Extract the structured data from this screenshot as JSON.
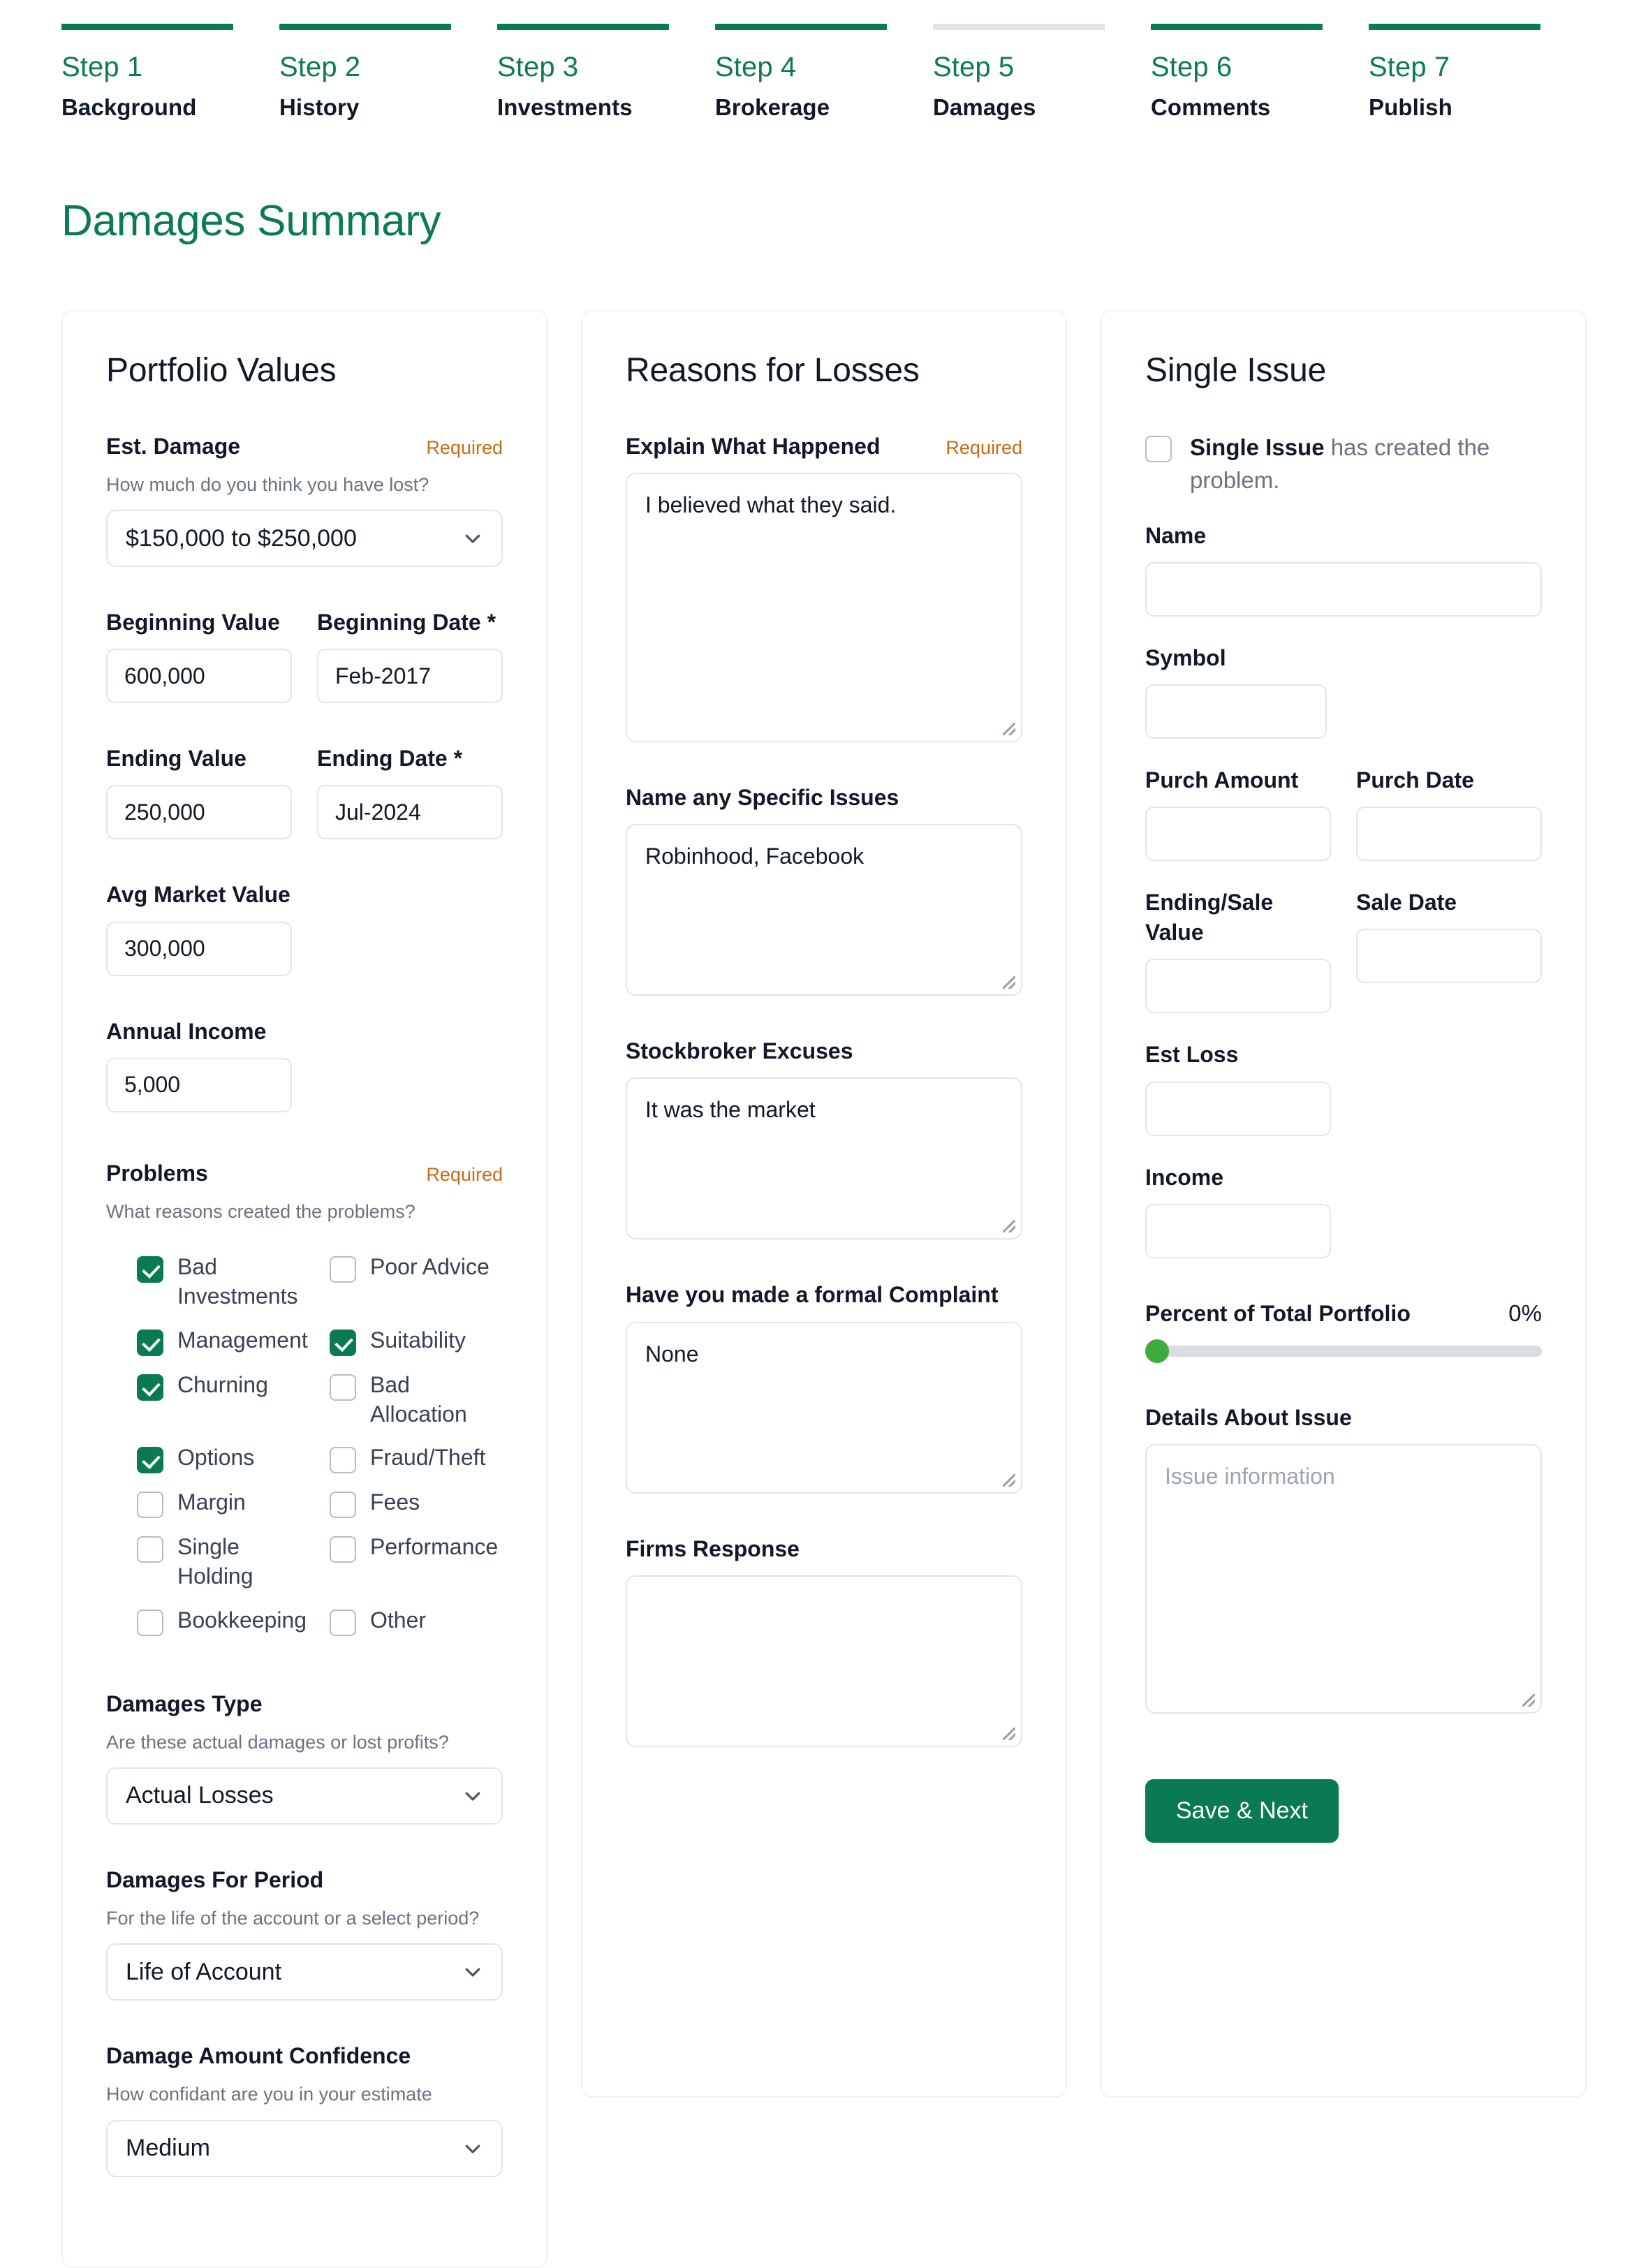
{
  "stepper": {
    "steps": [
      {
        "num": "Step 1",
        "name": "Background",
        "state": "done"
      },
      {
        "num": "Step 2",
        "name": "History",
        "state": "done"
      },
      {
        "num": "Step 3",
        "name": "Investments",
        "state": "done"
      },
      {
        "num": "Step 4",
        "name": "Brokerage",
        "state": "done"
      },
      {
        "num": "Step 5",
        "name": "Damages",
        "state": "current"
      },
      {
        "num": "Step 6",
        "name": "Comments",
        "state": "done"
      },
      {
        "num": "Step 7",
        "name": "Publish",
        "state": "done"
      }
    ]
  },
  "page": {
    "title": "Damages Summary"
  },
  "colors": {
    "brand_green": "#0b7a55",
    "required_orange": "#cc6a15",
    "checkbox_green": "#0b7a50",
    "slider_thumb_green": "#3faa3f",
    "step_inactive_gray": "#e3e6e8"
  },
  "portfolio": {
    "title": "Portfolio Values",
    "est_damage": {
      "label": "Est. Damage",
      "required": "Required",
      "help": "How much do you think you have lost?",
      "value": "$150,000 to $250,000"
    },
    "beginning_value": {
      "label": "Beginning Value",
      "value": "600,000"
    },
    "beginning_date": {
      "label": "Beginning Date *",
      "value": "Feb-2017"
    },
    "ending_value": {
      "label": "Ending Value",
      "value": "250,000"
    },
    "ending_date": {
      "label": "Ending Date *",
      "value": "Jul-2024"
    },
    "avg_market_value": {
      "label": "Avg Market Value",
      "value": "300,000"
    },
    "annual_income": {
      "label": "Annual Income",
      "value": "5,000"
    },
    "problems": {
      "label": "Problems",
      "required": "Required",
      "help": "What reasons created the problems?",
      "options": [
        {
          "label": "Bad Investments",
          "checked": true
        },
        {
          "label": "Poor Advice",
          "checked": false
        },
        {
          "label": "Management",
          "checked": true
        },
        {
          "label": "Suitability",
          "checked": true
        },
        {
          "label": "Churning",
          "checked": true
        },
        {
          "label": "Bad Allocation",
          "checked": false
        },
        {
          "label": "Options",
          "checked": true
        },
        {
          "label": "Fraud/Theft",
          "checked": false
        },
        {
          "label": "Margin",
          "checked": false
        },
        {
          "label": "Fees",
          "checked": false
        },
        {
          "label": "Single Holding",
          "checked": false
        },
        {
          "label": "Performance",
          "checked": false
        },
        {
          "label": "Bookkeeping",
          "checked": false
        },
        {
          "label": "Other",
          "checked": false
        }
      ]
    },
    "damages_type": {
      "label": "Damages Type",
      "help": "Are these actual damages or lost profits?",
      "value": "Actual Losses"
    },
    "damages_period": {
      "label": "Damages For Period",
      "help": "For the life of the account or a select period?",
      "value": "Life of Account"
    },
    "damage_confidence": {
      "label": "Damage Amount Confidence",
      "help": "How confidant are you in your estimate",
      "value": "Medium"
    }
  },
  "reasons": {
    "title": "Reasons for Losses",
    "explain": {
      "label": "Explain What Happened",
      "required": "Required",
      "value": "I believed what they said."
    },
    "specific_issues": {
      "label": "Name any Specific Issues",
      "value": "Robinhood, Facebook"
    },
    "excuses": {
      "label": "Stockbroker Excuses",
      "value": "It was the market"
    },
    "complaint": {
      "label": "Have you made a formal Complaint",
      "value": "None"
    },
    "firms_response": {
      "label": "Firms Response",
      "value": ""
    }
  },
  "single_issue": {
    "title": "Single Issue",
    "checkbox": {
      "strong": "Single Issue",
      "rest": " has created the problem.",
      "checked": false
    },
    "name": {
      "label": "Name",
      "value": ""
    },
    "symbol": {
      "label": "Symbol",
      "value": ""
    },
    "purch_amount": {
      "label": "Purch Amount",
      "value": ""
    },
    "purch_date": {
      "label": "Purch Date",
      "value": ""
    },
    "ending_sale_value": {
      "label": "Ending/Sale Value",
      "value": ""
    },
    "sale_date": {
      "label": "Sale Date",
      "value": ""
    },
    "est_loss": {
      "label": "Est Loss",
      "value": ""
    },
    "income": {
      "label": "Income",
      "value": ""
    },
    "percent_of_portfolio": {
      "label": "Percent of Total Portfolio",
      "value": "0%",
      "percent": 0
    },
    "details": {
      "label": "Details About Issue",
      "placeholder": "Issue information",
      "value": ""
    },
    "save_button": "Save & Next"
  }
}
